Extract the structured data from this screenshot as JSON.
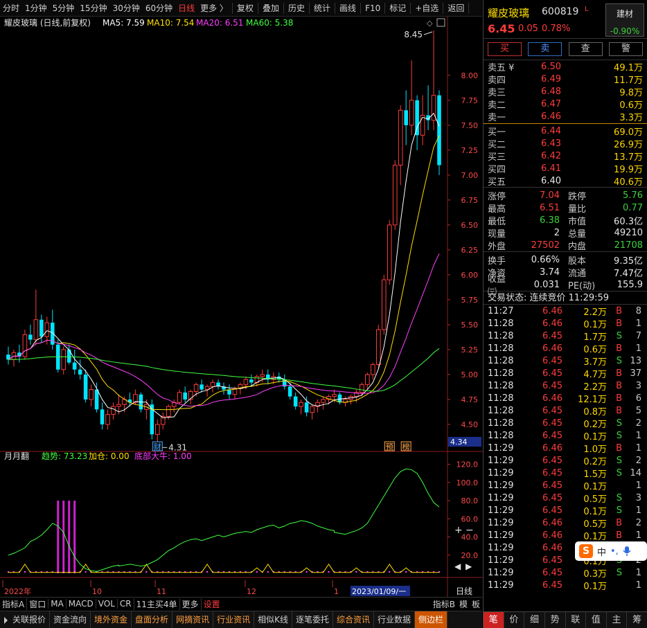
{
  "toolbar": {
    "periods": [
      "分时",
      "1分钟",
      "5分钟",
      "15分钟",
      "30分钟",
      "60分钟",
      "日线",
      "更多 〉"
    ],
    "active_period": "日线",
    "tools": [
      "复权",
      "叠加",
      "历史",
      "统计",
      "画线",
      "F10",
      "标记",
      "+自选",
      "返回"
    ]
  },
  "chart_header": {
    "title": "耀皮玻璃 (日线,前复权)",
    "ma5": "MA5: 7.59",
    "ma10": "MA10: 7.54",
    "ma20": "MA20: 6.51",
    "ma60": "MA60: 5.38",
    "colors": {
      "ma5": "#ffffff",
      "ma10": "#ffe000",
      "ma20": "#ff40ff",
      "ma60": "#40ff40"
    }
  },
  "chart_data": [
    {
      "type": "candlestick",
      "title": "耀皮玻璃 (日线,前复权)",
      "y_ticks": [
        "8.00",
        "7.75",
        "7.50",
        "7.25",
        "7.00",
        "6.75",
        "6.50",
        "6.25",
        "6.00",
        "5.75",
        "5.50",
        "5.25",
        "5.00",
        "4.75",
        "4.50"
      ],
      "ylim": [
        4.34,
        8.45
      ],
      "y_axis_label": "4.34",
      "x_ticks": [
        "2022年",
        "10",
        "11",
        "12",
        "1",
        "2023/01/09/一"
      ],
      "annotations": {
        "high": "8.45",
        "low": "4.31",
        "markers": [
          "财",
          "预",
          "榜"
        ]
      },
      "ohlc": [
        [
          5.2,
          5.28,
          5.1,
          5.15
        ],
        [
          5.15,
          5.25,
          5.08,
          5.22
        ],
        [
          5.22,
          5.3,
          5.12,
          5.18
        ],
        [
          5.18,
          5.45,
          5.15,
          5.4
        ],
        [
          5.4,
          5.5,
          5.3,
          5.35
        ],
        [
          5.35,
          5.85,
          5.3,
          5.55
        ],
        [
          5.55,
          5.6,
          5.32,
          5.38
        ],
        [
          5.38,
          5.58,
          5.3,
          5.52
        ],
        [
          5.52,
          5.65,
          5.25,
          5.3
        ],
        [
          5.3,
          5.35,
          5.02,
          5.05
        ],
        [
          5.05,
          5.28,
          5.0,
          5.25
        ],
        [
          5.25,
          5.3,
          5.1,
          5.12
        ],
        [
          5.12,
          5.25,
          5.0,
          5.05
        ],
        [
          5.05,
          5.15,
          4.95,
          5.0
        ],
        [
          5.0,
          5.05,
          4.72,
          4.75
        ],
        [
          4.75,
          4.9,
          4.68,
          4.85
        ],
        [
          4.85,
          4.92,
          4.62,
          4.65
        ],
        [
          4.65,
          4.72,
          4.45,
          4.5
        ],
        [
          4.5,
          4.65,
          4.45,
          4.6
        ],
        [
          4.6,
          4.72,
          4.55,
          4.68
        ],
        [
          4.68,
          4.8,
          4.6,
          4.7
        ],
        [
          4.7,
          4.78,
          4.62,
          4.75
        ],
        [
          4.75,
          4.82,
          4.68,
          4.72
        ],
        [
          4.72,
          4.85,
          4.7,
          4.8
        ],
        [
          4.8,
          4.82,
          4.62,
          4.65
        ],
        [
          4.65,
          4.75,
          4.55,
          4.7
        ],
        [
          4.7,
          4.75,
          4.35,
          4.4
        ],
        [
          4.4,
          4.55,
          4.31,
          4.5
        ],
        [
          4.5,
          4.62,
          4.45,
          4.58
        ],
        [
          4.58,
          4.7,
          4.55,
          4.68
        ],
        [
          4.68,
          4.75,
          4.62,
          4.72
        ],
        [
          4.72,
          4.85,
          4.7,
          4.82
        ],
        [
          4.82,
          4.88,
          4.72,
          4.75
        ],
        [
          4.75,
          4.85,
          4.7,
          4.83
        ],
        [
          4.83,
          4.92,
          4.78,
          4.9
        ],
        [
          4.9,
          4.95,
          4.82,
          4.85
        ],
        [
          4.85,
          4.9,
          4.78,
          4.88
        ],
        [
          4.88,
          4.95,
          4.82,
          4.92
        ],
        [
          4.92,
          4.95,
          4.85,
          4.88
        ],
        [
          4.88,
          4.92,
          4.8,
          4.85
        ],
        [
          4.85,
          4.9,
          4.75,
          4.8
        ],
        [
          4.8,
          4.88,
          4.75,
          4.86
        ],
        [
          4.86,
          4.92,
          4.8,
          4.9
        ],
        [
          4.9,
          4.98,
          4.85,
          4.95
        ],
        [
          4.95,
          5.0,
          4.88,
          4.92
        ],
        [
          4.92,
          5.0,
          4.88,
          4.98
        ],
        [
          4.98,
          5.05,
          4.92,
          5.0
        ],
        [
          5.0,
          5.05,
          4.9,
          4.95
        ],
        [
          4.95,
          5.02,
          4.9,
          4.98
        ],
        [
          4.98,
          5.02,
          4.92,
          4.95
        ],
        [
          4.95,
          5.0,
          4.85,
          4.88
        ],
        [
          4.88,
          4.92,
          4.75,
          4.78
        ],
        [
          4.78,
          4.82,
          4.65,
          4.68
        ],
        [
          4.68,
          4.75,
          4.6,
          4.72
        ],
        [
          4.72,
          4.78,
          4.58,
          4.62
        ],
        [
          4.62,
          4.7,
          4.55,
          4.68
        ],
        [
          4.68,
          4.75,
          4.62,
          4.72
        ],
        [
          4.72,
          4.78,
          4.65,
          4.75
        ],
        [
          4.75,
          4.8,
          4.7,
          4.78
        ],
        [
          4.78,
          4.85,
          4.72,
          4.8
        ],
        [
          4.8,
          4.82,
          4.7,
          4.72
        ],
        [
          4.72,
          4.78,
          4.68,
          4.75
        ],
        [
          4.75,
          4.8,
          4.7,
          4.78
        ],
        [
          4.78,
          4.85,
          4.72,
          4.82
        ],
        [
          4.82,
          4.92,
          4.78,
          4.9
        ],
        [
          4.9,
          5.02,
          4.85,
          5.0
        ],
        [
          5.0,
          5.12,
          4.95,
          5.1
        ],
        [
          5.1,
          5.5,
          5.05,
          5.45
        ],
        [
          5.45,
          6.0,
          5.4,
          5.95
        ],
        [
          5.95,
          6.55,
          5.9,
          6.5
        ],
        [
          6.5,
          7.15,
          6.45,
          7.1
        ],
        [
          7.1,
          7.7,
          6.9,
          7.65
        ],
        [
          7.65,
          7.85,
          7.3,
          7.5
        ],
        [
          7.5,
          8.15,
          7.4,
          7.75
        ],
        [
          7.75,
          7.8,
          7.25,
          7.4
        ],
        [
          7.4,
          7.8,
          7.3,
          7.6
        ],
        [
          7.6,
          7.9,
          7.45,
          7.55
        ],
        [
          7.55,
          8.45,
          7.45,
          7.8
        ],
        [
          7.8,
          7.85,
          7.0,
          7.1
        ]
      ],
      "series": [
        {
          "name": "MA5",
          "color": "#ffffff"
        },
        {
          "name": "MA10",
          "color": "#ffe000"
        },
        {
          "name": "MA20",
          "color": "#ff40ff"
        },
        {
          "name": "MA60",
          "color": "#40ff40"
        }
      ]
    },
    {
      "type": "line",
      "title": "月月翻",
      "y_ticks": [
        "120.0",
        "100.0",
        "80.0",
        "60.0",
        "40.0",
        "20.0"
      ],
      "ylim": [
        0,
        125
      ],
      "series": [
        {
          "name": "趋势",
          "label": "趋势: 73.23",
          "color": "#40ff40",
          "values": [
            20,
            22,
            25,
            28,
            35,
            38,
            42,
            48,
            55,
            52,
            45,
            30,
            18,
            10,
            5,
            3,
            2,
            4,
            6,
            8,
            9,
            8,
            9,
            10,
            9,
            8,
            9,
            12,
            15,
            20,
            25,
            28,
            32,
            35,
            37,
            38,
            36,
            38,
            40,
            42,
            40,
            42,
            44,
            45,
            46,
            45,
            48,
            50,
            52,
            53,
            50,
            52,
            55,
            56,
            58,
            57,
            55,
            52,
            50,
            48,
            47,
            45,
            44,
            43,
            45,
            47,
            50,
            55,
            65,
            75,
            85,
            95,
            105,
            112,
            115,
            114,
            110,
            100,
            88,
            78,
            73
          ]
        },
        {
          "name": "加仓",
          "label": "加仓: 0.00",
          "color": "#ffe000"
        },
        {
          "name": "底部大牛",
          "label": "底部大牛: 1.00",
          "color": "#ff40ff"
        }
      ]
    }
  ],
  "indicator_tabs": {
    "items": [
      "指标A",
      "窗口",
      "MA",
      "MACD",
      "VOL",
      "CR",
      "11主买4单",
      "更多",
      "设置"
    ],
    "highlight": "设置",
    "right": [
      "指标B",
      "模",
      "板"
    ]
  },
  "bottom_bar": [
    "关联报价",
    "资金流向",
    "境外资金",
    "盘面分析",
    "网摘资讯",
    "行业资讯",
    "相似K线",
    "逐笔委托",
    "综合资讯",
    "行业数据",
    "侧边栏"
  ],
  "bottom_bar_orange": [
    "境外资金",
    "盘面分析",
    "网摘资讯",
    "行业资讯",
    "综合资讯"
  ],
  "right_panel": {
    "name": "耀皮玻璃",
    "code": "600819",
    "flag": "L",
    "industry": {
      "name": "建材",
      "change": "-0.90%"
    },
    "price": "6.45",
    "change": "0.05",
    "pct": "0.78%",
    "actions": [
      "买",
      "卖",
      "查",
      "警"
    ],
    "asks": [
      {
        "label": "卖五 ¥",
        "price": "6.50",
        "vol": "49.1万"
      },
      {
        "label": "卖四",
        "price": "6.49",
        "vol": "11.7万"
      },
      {
        "label": "卖三",
        "price": "6.48",
        "vol": "9.8万"
      },
      {
        "label": "卖二",
        "price": "6.47",
        "vol": "0.6万"
      },
      {
        "label": "卖一",
        "price": "6.46",
        "vol": "3.3万"
      }
    ],
    "bids": [
      {
        "label": "买一",
        "price": "6.44",
        "vol": "69.0万"
      },
      {
        "label": "买二",
        "price": "6.43",
        "vol": "26.9万"
      },
      {
        "label": "买三",
        "price": "6.42",
        "vol": "13.7万"
      },
      {
        "label": "买四",
        "price": "6.41",
        "vol": "19.9万"
      },
      {
        "label": "买五",
        "price": "6.40",
        "vol": "40.6万"
      }
    ],
    "stats1": [
      {
        "k1": "涨停",
        "v1": "7.04",
        "c1": "red",
        "k2": "跌停",
        "v2": "5.76",
        "c2": "green"
      },
      {
        "k1": "最高",
        "v1": "6.51",
        "c1": "red",
        "k2": "量比",
        "v2": "0.77",
        "c2": "green"
      },
      {
        "k1": "最低",
        "v1": "6.38",
        "c1": "green",
        "k2": "市值",
        "v2": "60.3亿",
        "c2": "white"
      },
      {
        "k1": "现量",
        "v1": "2",
        "c1": "white",
        "k2": "总量",
        "v2": "49210",
        "c2": "white"
      },
      {
        "k1": "外盘",
        "v1": "27502",
        "c1": "red",
        "k2": "内盘",
        "v2": "21708",
        "c2": "green"
      }
    ],
    "stats2": [
      {
        "k1": "换手",
        "v1": "0.66%",
        "c1": "white",
        "k2": "股本",
        "v2": "9.35亿",
        "c2": "white"
      },
      {
        "k1": "净资",
        "v1": "3.74",
        "c1": "white",
        "k2": "流通",
        "v2": "7.47亿",
        "c2": "white"
      },
      {
        "k1": "收益㈢",
        "v1": "0.031",
        "c1": "white",
        "k2": "PE(动)",
        "v2": "155.9",
        "c2": "white"
      }
    ],
    "trade_status": "交易状态: 连续竞价 11:29:59",
    "ticks": [
      {
        "t": "11:27",
        "p": "6.46",
        "pc": "red",
        "v": "2.2万",
        "vc": "yellow",
        "d": "B",
        "dc": "red",
        "n": "8"
      },
      {
        "t": "11:28",
        "p": "6.46",
        "pc": "red",
        "v": "0.1万",
        "vc": "yellow",
        "d": "B",
        "dc": "red",
        "n": "1"
      },
      {
        "t": "11:28",
        "p": "6.45",
        "pc": "red",
        "v": "1.7万",
        "vc": "yellow",
        "d": "S",
        "dc": "green",
        "n": "7"
      },
      {
        "t": "11:28",
        "p": "6.46",
        "pc": "red",
        "v": "0.6万",
        "vc": "yellow",
        "d": "B",
        "dc": "red",
        "n": "1"
      },
      {
        "t": "11:28",
        "p": "6.45",
        "pc": "red",
        "v": "3.7万",
        "vc": "yellow",
        "d": "S",
        "dc": "green",
        "n": "13"
      },
      {
        "t": "11:28",
        "p": "6.45",
        "pc": "red",
        "v": "4.7万",
        "vc": "yellow",
        "d": "B",
        "dc": "red",
        "n": "37"
      },
      {
        "t": "11:28",
        "p": "6.45",
        "pc": "red",
        "v": "2.2万",
        "vc": "yellow",
        "d": "B",
        "dc": "red",
        "n": "3"
      },
      {
        "t": "11:28",
        "p": "6.46",
        "pc": "red",
        "v": "12.1万",
        "vc": "yellow",
        "d": "B",
        "dc": "red",
        "n": "6"
      },
      {
        "t": "11:28",
        "p": "6.45",
        "pc": "red",
        "v": "0.8万",
        "vc": "yellow",
        "d": "B",
        "dc": "red",
        "n": "5"
      },
      {
        "t": "11:28",
        "p": "6.45",
        "pc": "red",
        "v": "0.2万",
        "vc": "yellow",
        "d": "S",
        "dc": "green",
        "n": "2"
      },
      {
        "t": "11:28",
        "p": "6.45",
        "pc": "red",
        "v": "0.1万",
        "vc": "yellow",
        "d": "S",
        "dc": "green",
        "n": "1"
      },
      {
        "t": "11:29",
        "p": "6.46",
        "pc": "red",
        "v": "1.0万",
        "vc": "yellow",
        "d": "B",
        "dc": "red",
        "n": "1"
      },
      {
        "t": "11:29",
        "p": "6.45",
        "pc": "red",
        "v": "0.2万",
        "vc": "yellow",
        "d": "S",
        "dc": "green",
        "n": "2"
      },
      {
        "t": "11:29",
        "p": "6.45",
        "pc": "red",
        "v": "1.5万",
        "vc": "yellow",
        "d": "S",
        "dc": "green",
        "n": "14"
      },
      {
        "t": "11:29",
        "p": "6.45",
        "pc": "red",
        "v": "0.1万",
        "vc": "yellow",
        "d": "",
        "dc": "red",
        "n": "1"
      },
      {
        "t": "11:29",
        "p": "6.45",
        "pc": "red",
        "v": "0.5万",
        "vc": "yellow",
        "d": "S",
        "dc": "green",
        "n": "3"
      },
      {
        "t": "11:29",
        "p": "6.45",
        "pc": "red",
        "v": "0.1万",
        "vc": "yellow",
        "d": "S",
        "dc": "green",
        "n": "1"
      },
      {
        "t": "11:29",
        "p": "6.46",
        "pc": "red",
        "v": "0.5万",
        "vc": "yellow",
        "d": "B",
        "dc": "red",
        "n": "2"
      },
      {
        "t": "11:29",
        "p": "6.46",
        "pc": "red",
        "v": "0.1万",
        "vc": "yellow",
        "d": "B",
        "dc": "red",
        "n": "1"
      },
      {
        "t": "11:29",
        "p": "6.46",
        "pc": "red",
        "v": "",
        "vc": "yellow",
        "d": "",
        "dc": "red",
        "n": "1"
      },
      {
        "t": "11:29",
        "p": "6.45",
        "pc": "red",
        "v": "0.1万",
        "vc": "yellow",
        "d": "S",
        "dc": "green",
        "n": "2"
      },
      {
        "t": "11:29",
        "p": "6.45",
        "pc": "red",
        "v": "0.3万",
        "vc": "yellow",
        "d": "S",
        "dc": "green",
        "n": "1"
      },
      {
        "t": "11:29",
        "p": "6.45",
        "pc": "red",
        "v": "0.1万",
        "vc": "yellow",
        "d": "",
        "dc": "red",
        "n": "1"
      }
    ],
    "tabs": [
      "笔",
      "价",
      "细",
      "势",
      "联",
      "值",
      "主",
      "筹"
    ],
    "active_tab": "笔"
  },
  "ime": {
    "s": "S",
    "mode": "中",
    "punct": "•,"
  }
}
